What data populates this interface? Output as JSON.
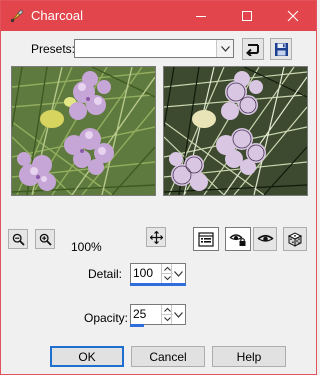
{
  "window": {
    "title": "Charcoal"
  },
  "presets": {
    "label": "Presets:",
    "value": ""
  },
  "zoom": {
    "level_text": "100%"
  },
  "detail": {
    "label": "Detail:",
    "value": "100",
    "fill_fraction": 1.0
  },
  "opacity": {
    "label": "Opacity:",
    "value": "25",
    "fill_fraction": 0.25
  },
  "buttons": {
    "ok": "OK",
    "cancel": "Cancel",
    "help": "Help"
  },
  "colors": {
    "titlebar": "#e2454b",
    "accent": "#2f6ddb",
    "default_border": "#1f6fd1"
  },
  "icons": {
    "app": "brush-icon",
    "minimize": "minimize-icon",
    "maximize": "maximize-icon",
    "close": "close-icon",
    "reset_preset": "reset-arrow-icon",
    "save_preset": "save-disk-icon",
    "zoom_out": "zoom-out-icon",
    "zoom_in": "zoom-in-icon",
    "pan": "pan-move-icon",
    "toggle_params": "settings-list-icon",
    "proof_lock": "eye-lock-icon",
    "proof": "eye-icon",
    "randomize": "dice-icon"
  }
}
